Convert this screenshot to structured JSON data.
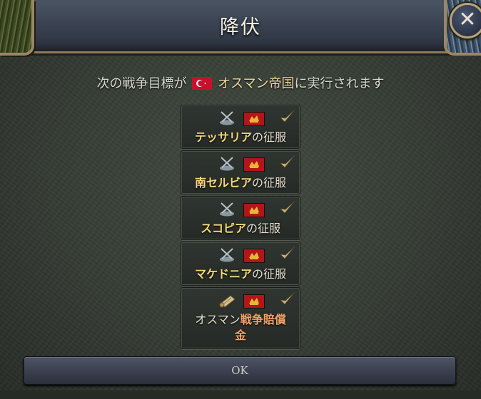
{
  "dialog": {
    "title": "降伏",
    "close_label": "✕"
  },
  "subtitle": {
    "prefix": "次の戦争目標が",
    "country": "オスマン帝国",
    "suffix": "に実行されます"
  },
  "goals": [
    {
      "type_icon": "crossed-swords-icon",
      "highlight": "テッサリア",
      "rest": "の征服",
      "status": "check"
    },
    {
      "type_icon": "crossed-swords-icon",
      "highlight": "南セルビア",
      "rest": "の征服",
      "status": "check"
    },
    {
      "type_icon": "crossed-swords-icon",
      "highlight": "スコピア",
      "rest": "の征服",
      "status": "check"
    },
    {
      "type_icon": "crossed-swords-icon",
      "highlight": "マケドニア",
      "rest": "の征服",
      "status": "check"
    },
    {
      "type_icon": "scroll-icon",
      "prefix": "オスマン",
      "highlight": "戦争賠償",
      "line2": "金",
      "status": "check"
    }
  ],
  "ok_button": {
    "label": "OK"
  },
  "colors": {
    "highlight": "#f7d878",
    "reparations": "#f3a36b",
    "check": "#c9b27a"
  }
}
